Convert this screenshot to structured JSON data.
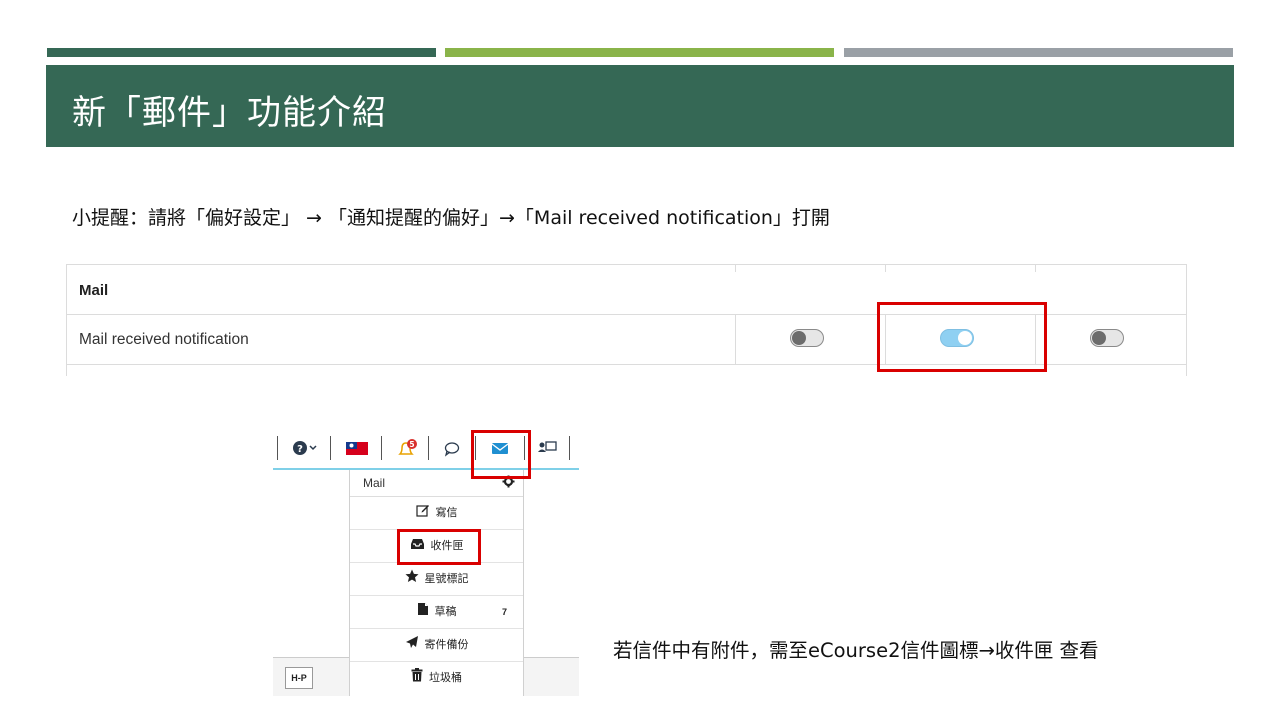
{
  "slide": {
    "title": "新「郵件」功能介紹",
    "tip": "小提醒：請將「偏好設定」 → 「通知提醒的偏好」→「Mail received notification」打開",
    "note": "若信件中有附件，需至eCourse2信件圖標→收件匣 查看"
  },
  "colors": {
    "accent_dark_green": "#356855",
    "accent_light_green": "#8ab44a",
    "accent_gray": "#9aa0a6",
    "highlight_red": "#d90000",
    "toggle_on": "#8fd0f2"
  },
  "preferences": {
    "section_label": "Mail",
    "row_label": "Mail received notification",
    "toggles": [
      {
        "state": "off"
      },
      {
        "state": "on"
      },
      {
        "state": "off"
      }
    ]
  },
  "navbar": {
    "icons": [
      "help-icon",
      "flag-icon",
      "bell-icon",
      "chat-icon",
      "envelope-icon",
      "contacts-icon"
    ],
    "notification_badge": "5",
    "hp_button": "H-P"
  },
  "mail_menu": {
    "title": "Mail",
    "items": [
      {
        "label": "寫信",
        "icon": "compose-icon"
      },
      {
        "label": "收件匣",
        "icon": "inbox-icon"
      },
      {
        "label": "星號標記",
        "icon": "star-icon"
      },
      {
        "label": "草稿",
        "icon": "draft-icon",
        "count": "7"
      },
      {
        "label": "寄件備份",
        "icon": "send-icon"
      },
      {
        "label": "垃圾桶",
        "icon": "trash-icon"
      }
    ]
  }
}
